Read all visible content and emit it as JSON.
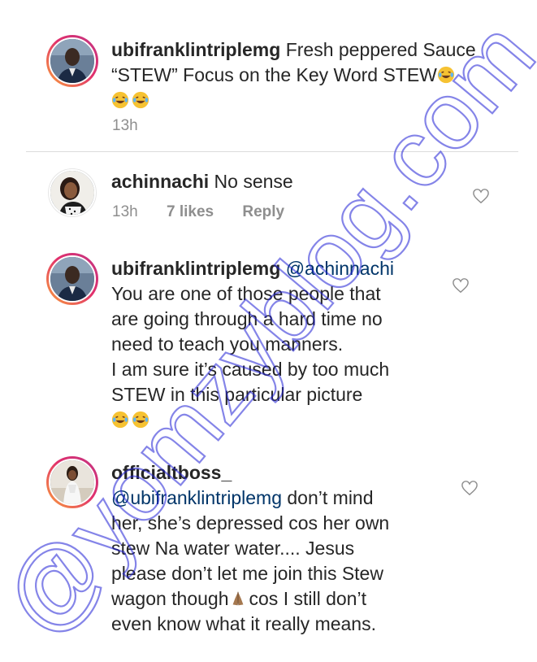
{
  "watermark": {
    "text": "@yomzyblog.com"
  },
  "comments": [
    {
      "username": "ubifranklintriplemg",
      "lines": [
        "Fresh peppered Sauce",
        "“STEW” Focus on the Key Word STEW"
      ],
      "emoji": [
        "laughing-tears-emoji",
        "laughing-tears-emoji",
        "laughing-tears-emoji"
      ],
      "time": "13h"
    },
    {
      "username": "achinnachi",
      "lines": [
        "No sense"
      ],
      "time": "13h",
      "likes": "7 likes",
      "reply": "Reply"
    },
    {
      "username": "ubifranklintriplemg",
      "mention": "@achinnachi",
      "lines": [
        "You are one of those people that",
        "are going through  a hard time no",
        "need to teach you manners.",
        "I am sure it’s caused by too much",
        "STEW in this particular picture"
      ],
      "emoji": [
        "laughing-tears-emoji",
        "laughing-tears-emoji"
      ]
    },
    {
      "username": "officialtboss_",
      "mention": "@ubifranklintriplemg",
      "first_line_rest": "don’t mind",
      "lines": [
        "her, she’s depressed cos her own",
        "stew Na water water.... Jesus",
        "please don’t let me join this Stew",
        "wagon though",
        "even know what it really means."
      ],
      "inline_after_wagon": "cos I still don’t",
      "emoji": [
        "praying-hands-emoji"
      ]
    }
  ],
  "colors": {
    "text": "#262626",
    "meta": "#8e8e8e",
    "watermark": "#1f1fd6",
    "divider": "#dbdbdb"
  }
}
